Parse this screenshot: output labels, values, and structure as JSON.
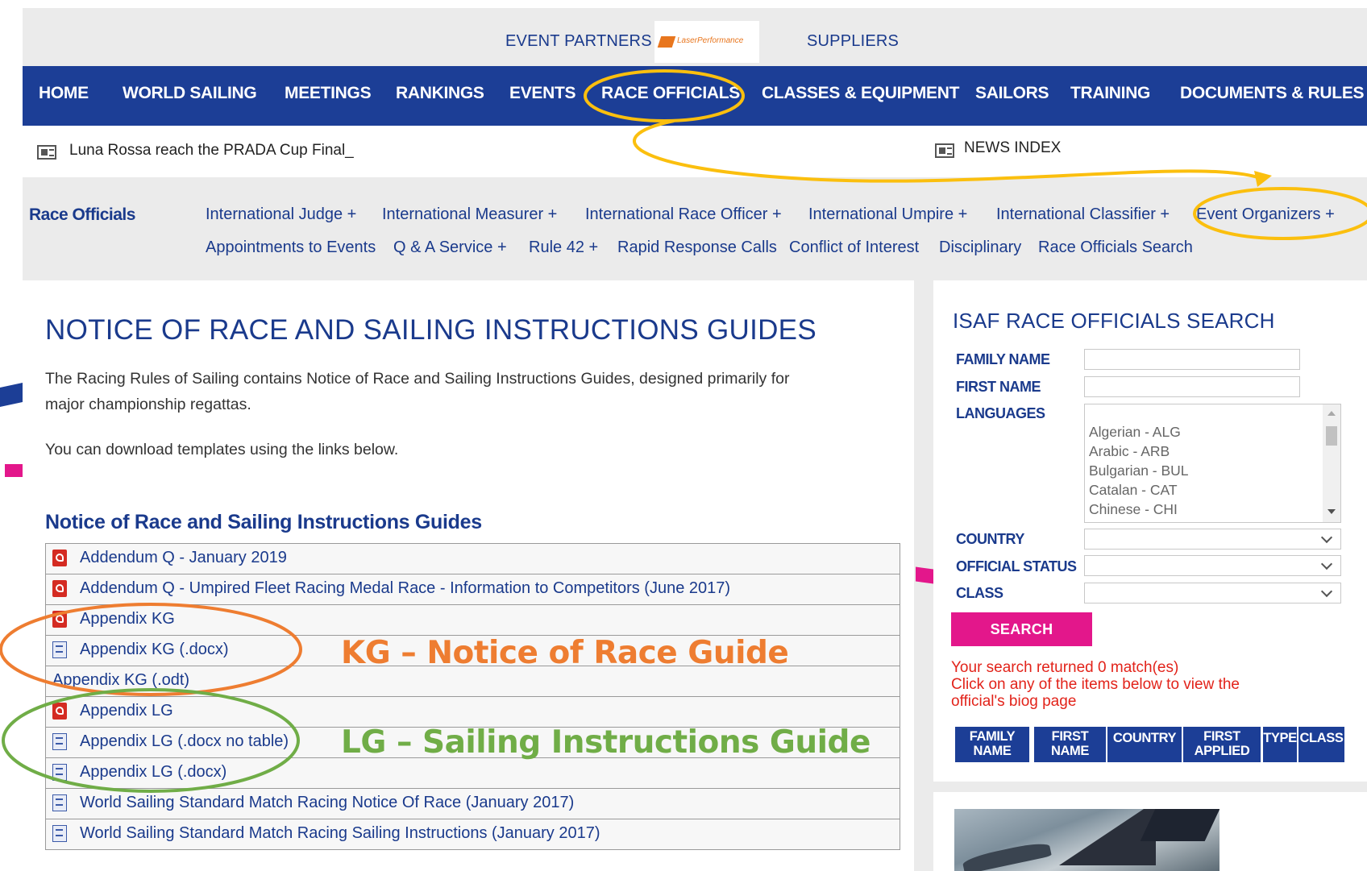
{
  "partners_bar": {
    "event_partners": "EVENT PARTNERS",
    "partner_logo_text": "LaserPerformance",
    "suppliers": "SUPPLIERS"
  },
  "main_nav": {
    "items": [
      "HOME",
      "WORLD SAILING",
      "MEETINGS",
      "RANKINGS",
      "EVENTS",
      "RACE OFFICIALS",
      "CLASSES & EQUIPMENT",
      "SAILORS",
      "TRAINING",
      "DOCUMENTS & RULES"
    ]
  },
  "news": {
    "headline": "Luna Rossa reach the PRADA Cup Final_",
    "index": "NEWS INDEX"
  },
  "subnav": {
    "title": "Race Officials",
    "row1": [
      "International Judge +",
      "International Measurer +",
      "International Race Officer +",
      "International Umpire +",
      "International Classifier +",
      "Event Organizers +"
    ],
    "row2": [
      "Appointments to Events",
      "Q & A Service +",
      "Rule 42 +",
      "Rapid Response Calls",
      "Conflict of Interest",
      "Disciplinary",
      "Race Officials Search"
    ]
  },
  "main": {
    "title": "NOTICE OF RACE AND SAILING INSTRUCTIONS GUIDES",
    "intro_line1": "The Racing Rules of Sailing contains Notice of Race and Sailing Instructions Guides, designed primarily for",
    "intro_line2": "major championship regattas.",
    "download_text": "You can download templates using the links below.",
    "section_title": "Notice of Race and Sailing Instructions Guides",
    "documents": [
      {
        "label": "Addendum Q - January 2019",
        "icon": "pdf-icon"
      },
      {
        "label": "Addendum Q - Umpired Fleet Racing Medal Race - Information to Competitors (June 2017)",
        "icon": "pdf-icon"
      },
      {
        "label": "Appendix KG",
        "icon": "pdf-icon"
      },
      {
        "label": "Appendix KG (.docx)",
        "icon": "word-icon"
      },
      {
        "label": "Appendix KG (.odt)",
        "icon": "none"
      },
      {
        "label": "Appendix LG",
        "icon": "pdf-icon"
      },
      {
        "label": "Appendix LG (.docx no table)",
        "icon": "word-icon"
      },
      {
        "label": "Appendix LG (.docx)",
        "icon": "word-icon"
      },
      {
        "label": "World Sailing Standard Match Racing Notice Of Race (January 2017)",
        "icon": "word-icon"
      },
      {
        "label": "World Sailing Standard Match Racing Sailing Instructions (January 2017)",
        "icon": "word-icon"
      }
    ]
  },
  "sidebar": {
    "title": "ISAF RACE OFFICIALS SEARCH",
    "labels": {
      "family_name": "FAMILY NAME",
      "first_name": "FIRST NAME",
      "languages": "LANGUAGES",
      "country": "COUNTRY",
      "official_status": "OFFICIAL STATUS",
      "class": "CLASS"
    },
    "family_name_value": "",
    "first_name_value": "",
    "languages_options": [
      "Algerian - ALG",
      "Arabic - ARB",
      "Bulgarian - BUL",
      "Catalan - CAT",
      "Chinese - CHI"
    ],
    "country_value": "",
    "official_status_value": "",
    "class_value": "",
    "search_button": "SEARCH",
    "result_line1": "Your search returned 0 match(es)",
    "result_line2": "Click on any of the items below to view the",
    "result_line3": "official's biog page",
    "table_headers": {
      "family_l1": "FAMILY",
      "family_l2": "NAME",
      "first_l1": "FIRST",
      "first_l2": "NAME",
      "country": "COUNTRY",
      "applied_l1": "FIRST",
      "applied_l2": "APPLIED",
      "type": "TYPE",
      "class": "CLASS"
    }
  },
  "annotations": {
    "kg": "KG – Notice of Race Guide",
    "lg": "LG – Sailing Instructions Guide",
    "kg_color": "#ee7d31",
    "lg_color": "#70ad47",
    "highlight_color": "#fbbf0e"
  },
  "colors": {
    "nav_blue": "#1c3e96",
    "link_blue": "#1a3a8c",
    "accent_pink": "#e3178b",
    "result_red": "#e2231a"
  }
}
